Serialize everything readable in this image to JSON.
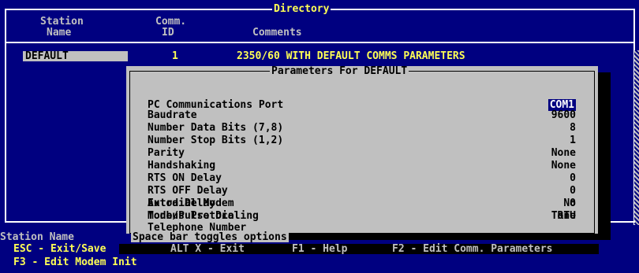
{
  "window": {
    "title": "Directory"
  },
  "table": {
    "headers": {
      "station_line1": "Station",
      "station_line2": "Name",
      "comm_line1": "Comm.",
      "comm_line2": "ID",
      "comments": "Comments"
    },
    "rows": [
      {
        "name": "DEFAULT",
        "id": "1",
        "comment": "2350/60 WITH DEFAULT COMMS PARAMETERS"
      }
    ]
  },
  "dialog": {
    "title": "Parameters For DEFAULT",
    "footer": "Space bar toggles options",
    "fields": [
      {
        "label": "PC Communications Port",
        "value": "COM1"
      },
      {
        "label": "Baudrate",
        "value": "9600"
      },
      {
        "label": "Number Data Bits (7,8)",
        "value": "8"
      },
      {
        "label": "Number Stop Bits (1,2)",
        "value": "1"
      },
      {
        "label": "Parity",
        "value": "None"
      },
      {
        "label": "Handshaking",
        "value": "None"
      },
      {
        "label": "RTS ON Delay",
        "value": "0"
      },
      {
        "label": "RTS OFF Delay",
        "value": "0"
      },
      {
        "label": "Extra Delay",
        "value": "0"
      },
      {
        "label": "Modbus Protocol",
        "value": "RTU"
      },
      {
        "label": "Autodial Modem",
        "value": "No"
      },
      {
        "label": "Tone/Pulse Dialing",
        "value": "Tone"
      },
      {
        "label": "Telephone Number",
        "value": ""
      }
    ]
  },
  "status": {
    "search_label": "Station Name",
    "esc": "ESC - Exit/Save",
    "alt_x": "ALT X - Exit",
    "f1": "F1 - Help",
    "f2": "F2 - Edit Comm. Parameters",
    "f3": "F3 - Edit Modem Init"
  },
  "colors": {
    "screen_background": "#000080",
    "dialog_background": "#c0c0c0",
    "highlight_text": "#ffff55",
    "header_text": "#c0c0c0",
    "selected_value_background": "#000080"
  }
}
